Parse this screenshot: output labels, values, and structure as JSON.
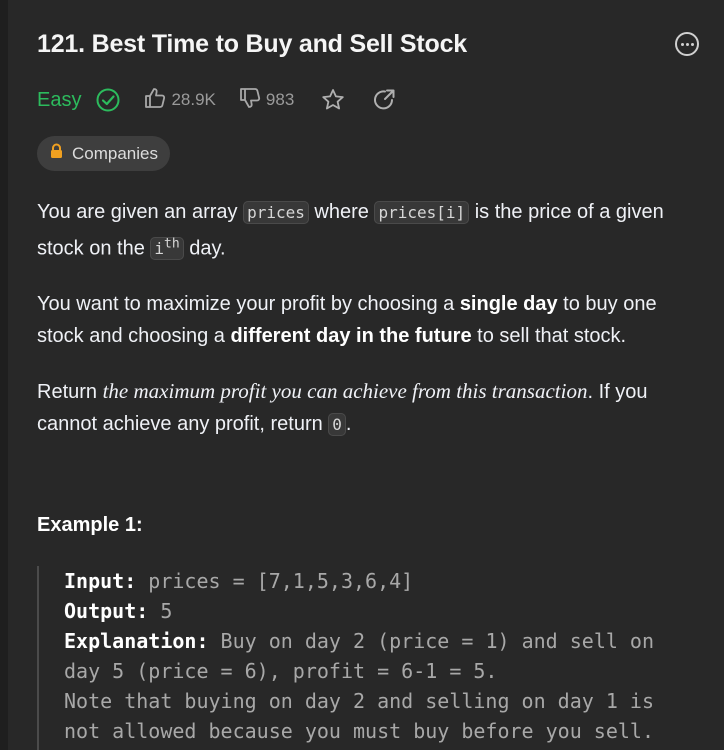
{
  "problem": {
    "title": "121. Best Time to Buy and Sell Stock",
    "difficulty": "Easy",
    "likes": "28.9K",
    "dislikes": "983",
    "companies_label": "Companies"
  },
  "description": {
    "p1_a": "You are given an array ",
    "p1_code1": "prices",
    "p1_b": " where ",
    "p1_code2": "prices[i]",
    "p1_c": " is the price of a given stock on the ",
    "p1_code3": "i",
    "p1_sup": "th",
    "p1_d": " day.",
    "p2_a": "You want to maximize your profit by choosing a ",
    "p2_b1": "single day",
    "p2_b": " to buy one stock and choosing a ",
    "p2_b2": "different day in the future",
    "p2_c": " to sell that stock.",
    "p3_a": "Return ",
    "p3_em": "the maximum profit you can achieve from this transaction",
    "p3_b": ". If you cannot achieve any profit, return ",
    "p3_code": "0",
    "p3_c": "."
  },
  "example": {
    "title": "Example 1:",
    "input_label": "Input:",
    "input_value": " prices = [7,1,5,3,6,4]",
    "output_label": "Output:",
    "output_value": " 5",
    "explanation_label": "Explanation:",
    "explanation_value": " Buy on day 2 (price = 1) and sell on",
    "explanation_line2": "day 5 (price = 6), profit = 6-1 = 5.",
    "note_line1": "Note that buying on day 2 and selling on day 1 is",
    "note_line2": "not allowed because you must buy before you sell."
  },
  "colors": {
    "background": "#282828",
    "difficulty_easy": "#2cbb5d",
    "chip_bg": "#3e3e3e"
  },
  "icons": [
    "more-options-icon",
    "solved-check-icon",
    "thumbs-up-icon",
    "thumbs-down-icon",
    "star-icon",
    "share-icon",
    "lock-icon"
  ]
}
